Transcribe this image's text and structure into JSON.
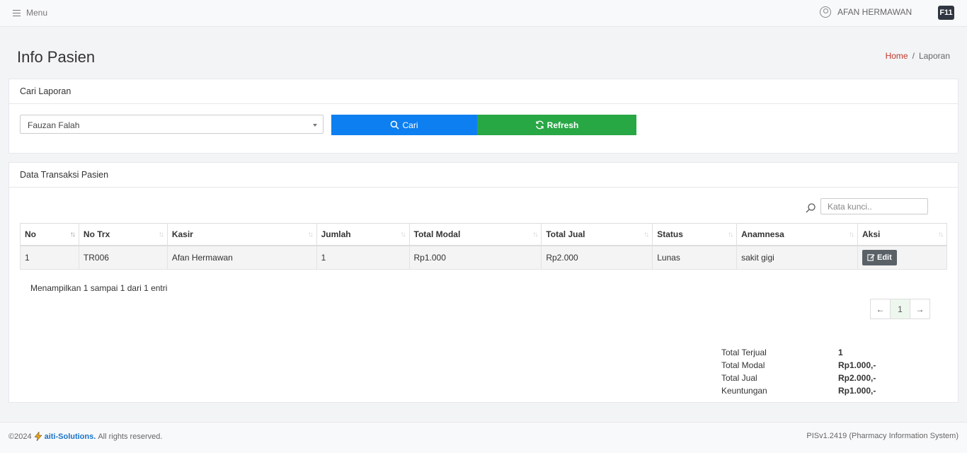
{
  "topbar": {
    "menu_label": "Menu",
    "user_name": "AFAN HERMAWAN",
    "shortcut_badge": "F11"
  },
  "page": {
    "title": "Info Pasien",
    "breadcrumb": {
      "home": "Home",
      "separator": "/",
      "current": "Laporan"
    }
  },
  "search_card": {
    "title": "Cari Laporan",
    "patient_select_value": "Fauzan Falah",
    "search_button": "Cari",
    "refresh_button": "Refresh"
  },
  "data_card": {
    "title": "Data Transaksi Pasien",
    "keyword_placeholder": "Kata kunci..",
    "columns": [
      "No",
      "No Trx",
      "Kasir",
      "Jumlah",
      "Total Modal",
      "Total Jual",
      "Status",
      "Anamnesa",
      "Aksi"
    ],
    "rows": [
      {
        "no": "1",
        "no_trx": "TR006",
        "kasir": "Afan Hermawan",
        "jumlah": "1",
        "total_modal": "Rp1.000",
        "total_jual": "Rp2.000",
        "status": "Lunas",
        "anamnesa": "sakit gigi",
        "aksi": "Edit"
      }
    ],
    "info_text": "Menampilkan 1 sampai 1 dari 1 entri",
    "pagination": {
      "current_page": "1"
    },
    "totals": [
      {
        "label": "Total Terjual",
        "value": "1"
      },
      {
        "label": "Total Modal",
        "value": "Rp1.000,-"
      },
      {
        "label": "Total Jual",
        "value": "Rp2.000,-"
      },
      {
        "label": "Keuntungan",
        "value": "Rp1.000,-"
      }
    ]
  },
  "footer": {
    "copyright": "©2024",
    "brand": "aiti-Solutions.",
    "rights": "All rights reserved.",
    "version": "PISv1.2419 (Pharmacy Information System)"
  },
  "colors": {
    "primary_button": "#0d7ff0",
    "success_button": "#28a745",
    "breadcrumb_home": "#c0392b",
    "edit_button": "#5a6268"
  }
}
